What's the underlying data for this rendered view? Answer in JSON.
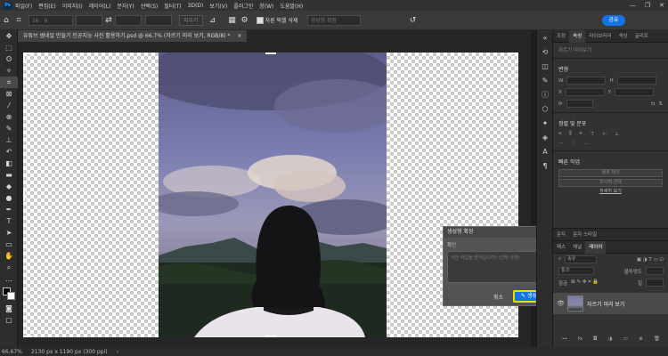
{
  "app": {
    "logo": "Ps"
  },
  "menu": [
    "파일(F)",
    "편집(E)",
    "이미지(I)",
    "레이어(L)",
    "문자(Y)",
    "선택(S)",
    "필터(T)",
    "3D(D)",
    "보기(V)",
    "플러그인",
    "창(W)",
    "도움말(H)"
  ],
  "window_controls": {
    "minimize": "—",
    "maximize": "❐",
    "close": "✕"
  },
  "options": {
    "ratio_value": "16 : 9",
    "straighten_label": "지우기",
    "delete_crop_label": "자른 픽셀 삭제",
    "content_aware_label": "생성형 확장",
    "reset_icon": "↺",
    "share_label": "공유"
  },
  "document": {
    "tab_title": "유튜브 썸네일 만들기 인공지능 사진 활용하기.psd @ 66.7% (자르기 미리 보기, RGB/8) *",
    "close": "×"
  },
  "dialog": {
    "title": "생성형 확장",
    "close": "×",
    "prompt_label": "확인",
    "placeholder": "어떤 작업을 원하십니까? (선택 사항)",
    "cancel_label": "취소",
    "generate_label": "생성",
    "generate_icon": "✎"
  },
  "panel": {
    "tabs": [
      "조정",
      "속성",
      "라이브러리",
      "색상",
      "글리프"
    ],
    "active_tab": 1,
    "subtitle": "자르기 미리보기",
    "transform_label": "변형",
    "w_label": "W",
    "h_label": "H",
    "x_label": "X",
    "y_label": "Y",
    "align_label": "정렬 및 분포",
    "quick_actions_label": "빠른 작업",
    "quick_btn1": "배경 제거",
    "quick_btn2": "피사체 선택",
    "more_link": "자세히 보기"
  },
  "layers": {
    "tabs": [
      "문자",
      "문자 스타일"
    ],
    "subtabs": [
      "패스",
      "채널",
      "레이어"
    ],
    "filter_label": "종류",
    "mode_label": "통과",
    "opacity_label": "불투명도",
    "lock_label": "잠금",
    "fill_label": "칠",
    "layer_name": "자르기 미리 보기",
    "visibility_icon": "👁"
  },
  "status": {
    "zoom": "66.67%",
    "doc_info": "2130 px x 1190 px (300 ppi)",
    "arrow": "›"
  }
}
